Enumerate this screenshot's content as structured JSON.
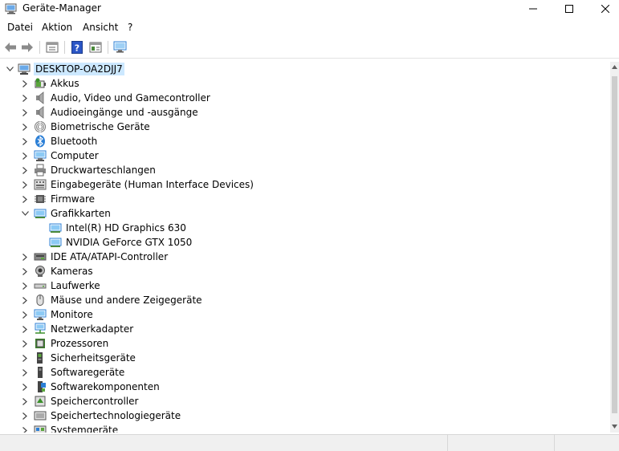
{
  "window": {
    "title": "Geräte-Manager"
  },
  "menu": [
    "Datei",
    "Aktion",
    "Ansicht",
    "?"
  ],
  "toolbar": [
    "back-icon",
    "forward-icon",
    "properties-icon",
    "help-icon",
    "view-icon",
    "monitor-scan-icon"
  ],
  "tree": {
    "root": "DESKTOP-OA2DJJ7",
    "categories": [
      {
        "label": "Akkus",
        "icon": "battery-icon",
        "expanded": false
      },
      {
        "label": "Audio, Video und Gamecontroller",
        "icon": "speaker-icon",
        "expanded": false
      },
      {
        "label": "Audioeingänge und -ausgänge",
        "icon": "speaker-icon",
        "expanded": false
      },
      {
        "label": "Biometrische Geräte",
        "icon": "fingerprint-icon",
        "expanded": false
      },
      {
        "label": "Bluetooth",
        "icon": "bluetooth-icon",
        "expanded": false
      },
      {
        "label": "Computer",
        "icon": "computer-icon",
        "expanded": false
      },
      {
        "label": "Druckwarteschlangen",
        "icon": "printer-icon",
        "expanded": false
      },
      {
        "label": "Eingabegeräte (Human Interface Devices)",
        "icon": "hid-icon",
        "expanded": false
      },
      {
        "label": "Firmware",
        "icon": "chip-icon",
        "expanded": false
      },
      {
        "label": "Grafikkarten",
        "icon": "display-adapter-icon",
        "expanded": true,
        "children": [
          "Intel(R) HD Graphics 630",
          "NVIDIA GeForce GTX 1050"
        ]
      },
      {
        "label": "IDE ATA/ATAPI-Controller",
        "icon": "ide-icon",
        "expanded": false
      },
      {
        "label": "Kameras",
        "icon": "camera-icon",
        "expanded": false
      },
      {
        "label": "Laufwerke",
        "icon": "drive-icon",
        "expanded": false
      },
      {
        "label": "Mäuse und andere Zeigegeräte",
        "icon": "mouse-icon",
        "expanded": false
      },
      {
        "label": "Monitore",
        "icon": "monitor-icon",
        "expanded": false
      },
      {
        "label": "Netzwerkadapter",
        "icon": "network-icon",
        "expanded": false
      },
      {
        "label": "Prozessoren",
        "icon": "processor-icon",
        "expanded": false
      },
      {
        "label": "Sicherheitsgeräte",
        "icon": "security-device-icon",
        "expanded": false
      },
      {
        "label": "Softwaregeräte",
        "icon": "software-device-icon",
        "expanded": false
      },
      {
        "label": "Softwarekomponenten",
        "icon": "software-component-icon",
        "expanded": false
      },
      {
        "label": "Speichercontroller",
        "icon": "storage-controller-icon",
        "expanded": false
      },
      {
        "label": "Speichertechnologiegeräte",
        "icon": "storage-tech-icon",
        "expanded": false
      },
      {
        "label": "Systemgeräte",
        "icon": "system-icon",
        "expanded": false
      }
    ]
  },
  "colors": {
    "selection": "#cce8ff",
    "icon_blue": "#2b7fd6",
    "chevron": "#444444"
  }
}
